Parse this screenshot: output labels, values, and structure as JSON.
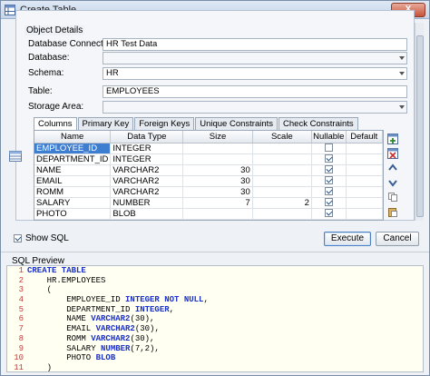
{
  "window": {
    "title": "Create Table",
    "close_label": "X"
  },
  "object_details": {
    "group_label": "Object Details",
    "fields": [
      {
        "label": "Database Connection:",
        "value": "HR Test Data",
        "type": "text"
      },
      {
        "label": "Database:",
        "value": "",
        "type": "dropdown-disabled"
      },
      {
        "label": "Schema:",
        "value": "HR",
        "type": "dropdown"
      },
      {
        "label": "Table:",
        "value": "EMPLOYEES",
        "type": "text"
      },
      {
        "label": "Storage Area:",
        "value": "",
        "type": "dropdown-disabled"
      }
    ]
  },
  "tabs": [
    "Columns",
    "Primary Key",
    "Foreign Keys",
    "Unique Constraints",
    "Check Constraints"
  ],
  "columns_table": {
    "headers": [
      "Name",
      "Data Type",
      "Size",
      "Scale",
      "Nullable",
      "Default"
    ],
    "rows": [
      {
        "name": "EMPLOYEE_ID",
        "type": "INTEGER",
        "size": "",
        "scale": "",
        "nullable": false,
        "default": ""
      },
      {
        "name": "DEPARTMENT_ID",
        "type": "INTEGER",
        "size": "",
        "scale": "",
        "nullable": true,
        "default": ""
      },
      {
        "name": "NAME",
        "type": "VARCHAR2",
        "size": "30",
        "scale": "",
        "nullable": true,
        "default": ""
      },
      {
        "name": "EMAIL",
        "type": "VARCHAR2",
        "size": "30",
        "scale": "",
        "nullable": true,
        "default": ""
      },
      {
        "name": "ROMM",
        "type": "VARCHAR2",
        "size": "30",
        "scale": "",
        "nullable": true,
        "default": ""
      },
      {
        "name": "SALARY",
        "type": "NUMBER",
        "size": "7",
        "scale": "2",
        "nullable": true,
        "default": ""
      },
      {
        "name": "PHOTO",
        "type": "BLOB",
        "size": "",
        "scale": "",
        "nullable": true,
        "default": ""
      }
    ]
  },
  "show_sql": {
    "label": "Show SQL",
    "checked": true
  },
  "buttons": {
    "execute": "Execute",
    "cancel": "Cancel"
  },
  "sql_preview": {
    "label": "SQL Preview",
    "lines": [
      {
        "n": "1",
        "parts": [
          [
            "kw",
            "CREATE TABLE"
          ]
        ]
      },
      {
        "n": "2",
        "parts": [
          [
            "",
            "    HR.EMPLOYEES"
          ]
        ]
      },
      {
        "n": "3",
        "parts": [
          [
            "",
            "    ("
          ]
        ]
      },
      {
        "n": "4",
        "parts": [
          [
            "",
            "        EMPLOYEE_ID "
          ],
          [
            "kw",
            "INTEGER NOT NULL"
          ],
          [
            "",
            ","
          ]
        ]
      },
      {
        "n": "5",
        "parts": [
          [
            "",
            "        DEPARTMENT_ID "
          ],
          [
            "kw",
            "INTEGER"
          ],
          [
            "",
            ","
          ]
        ]
      },
      {
        "n": "6",
        "parts": [
          [
            "",
            "        NAME "
          ],
          [
            "kw",
            "VARCHAR2"
          ],
          [
            "",
            "(30),"
          ]
        ]
      },
      {
        "n": "7",
        "parts": [
          [
            "",
            "        EMAIL "
          ],
          [
            "kw",
            "VARCHAR2"
          ],
          [
            "",
            "(30),"
          ]
        ]
      },
      {
        "n": "8",
        "parts": [
          [
            "",
            "        ROMM "
          ],
          [
            "kw",
            "VARCHAR2"
          ],
          [
            "",
            "(30),"
          ]
        ]
      },
      {
        "n": "9",
        "parts": [
          [
            "",
            "        SALARY "
          ],
          [
            "kw",
            "NUMBER"
          ],
          [
            "",
            "(7,2),"
          ]
        ]
      },
      {
        "n": "10",
        "parts": [
          [
            "",
            "        PHOTO "
          ],
          [
            "kw",
            "BLOB"
          ]
        ]
      },
      {
        "n": "11",
        "parts": [
          [
            "",
            "    )"
          ]
        ]
      }
    ]
  },
  "colors": {
    "selection": "#3d7ed1",
    "keyword": "#1a2fc7",
    "line_number": "#c23c3c",
    "sql_background": "#fffff2"
  },
  "icons": [
    "table-icon",
    "add-column-icon",
    "remove-column-icon",
    "move-up-icon",
    "move-down-icon",
    "copy-icon",
    "paste-icon",
    "table-grid-icon"
  ]
}
